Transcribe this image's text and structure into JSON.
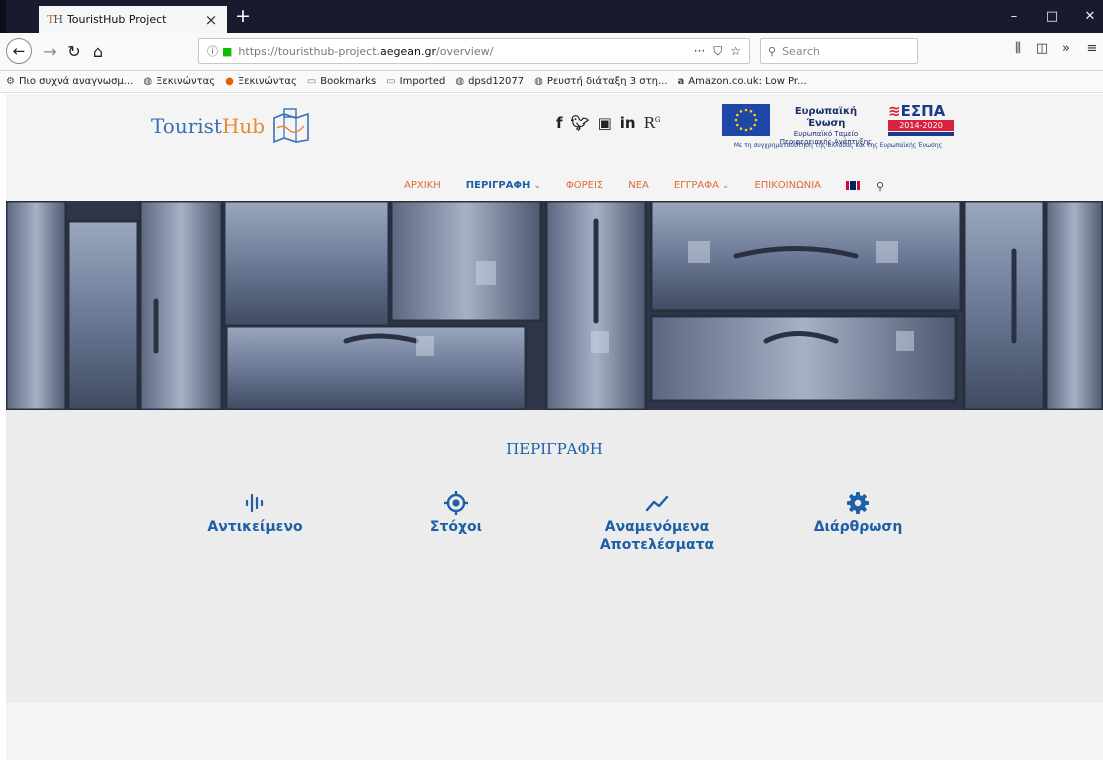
{
  "browser": {
    "tab_title": "TouristHub Project",
    "tab_close": "×",
    "new_tab": "+",
    "url_prefix": "https://touristhub-project.",
    "url_domain": "aegean.gr",
    "url_path": "/overview/",
    "search_placeholder": "Search",
    "page_actions": "···",
    "win_minimize": "–",
    "win_maximize": "□",
    "win_close": "✕",
    "bookmarks": [
      {
        "label": "Πιο συχνά αναγνωσμ...",
        "icon": "gear-icon"
      },
      {
        "label": "Ξεκινώντας",
        "icon": "globe-icon"
      },
      {
        "label": "Ξεκινώντας",
        "icon": "firefox-icon"
      },
      {
        "label": "Bookmarks",
        "icon": "folder-icon"
      },
      {
        "label": "Imported",
        "icon": "folder-icon"
      },
      {
        "label": "dpsd12077",
        "icon": "globe-icon"
      },
      {
        "label": "Ρευστή διάταξη 3 στη...",
        "icon": "globe-icon"
      },
      {
        "label": "Amazon.co.uk: Low Pr...",
        "icon": "amazon-icon"
      }
    ]
  },
  "site": {
    "logo_main": "Tourist",
    "logo_accent": "Hub",
    "eu": {
      "title": "Ευρωπαϊκή Ένωση",
      "line1": "Ευρωπαϊκό Ταμείο",
      "line2": "Περιφερειακής Ανάπτυξης",
      "espa": "ΕΣΠΑ",
      "years": "2014-2020",
      "caption": "Με τη συγχρηματοδότηση της Ελλάδας και της Ευρωπαϊκής Ένωσης"
    },
    "nav": [
      {
        "label": "ΑΡΧΙΚΗ",
        "active": false,
        "dropdown": false
      },
      {
        "label": "ΠΕΡΙΓΡΑΦΗ",
        "active": true,
        "dropdown": true
      },
      {
        "label": "ΦΟΡΕΙΣ",
        "active": false,
        "dropdown": false
      },
      {
        "label": "ΝΕΑ",
        "active": false,
        "dropdown": false
      },
      {
        "label": "ΕΓΓΡΑΦΑ",
        "active": false,
        "dropdown": true
      },
      {
        "label": "ΕΠΙΚΟΙΝΩΝΙΑ",
        "active": false,
        "dropdown": false
      }
    ],
    "section_title": "ΠΕΡΙΓΡΑΦΗ",
    "features": [
      {
        "label": "Αντικείμενο",
        "icon": "audio-wave-icon"
      },
      {
        "label": "Στόχοι",
        "icon": "target-icon"
      },
      {
        "label": "Αναμενόμενα Αποτελέσματα",
        "icon": "trend-line-icon"
      },
      {
        "label": "Διάρθρωση",
        "icon": "gear-icon"
      }
    ]
  },
  "colors": {
    "brand_blue": "#1d5fa8",
    "nav_orange": "#e06a37",
    "logo_orange": "#e38b2f"
  }
}
